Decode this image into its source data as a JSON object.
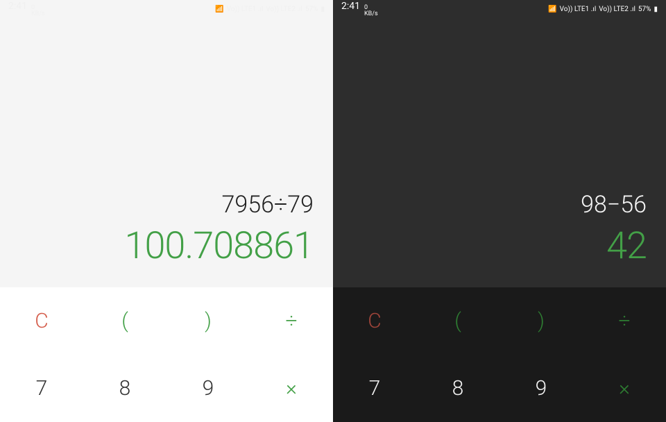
{
  "statusbar": {
    "time": "2:41",
    "data_rate_value": "0",
    "data_rate_unit": "KB/s",
    "lte1": "Vo)) LTE1 .ıl",
    "lte2": "Vo)) LTE2 .ıl",
    "battery": "57%"
  },
  "left": {
    "expression": "7956÷79",
    "result": "100.708861"
  },
  "right": {
    "expression": "98−56",
    "result": "42"
  },
  "keys": {
    "clear": "C",
    "lparen": "(",
    "rparen": ")",
    "divide": "÷",
    "seven": "7",
    "eight": "8",
    "nine": "9",
    "multiply": "×"
  }
}
